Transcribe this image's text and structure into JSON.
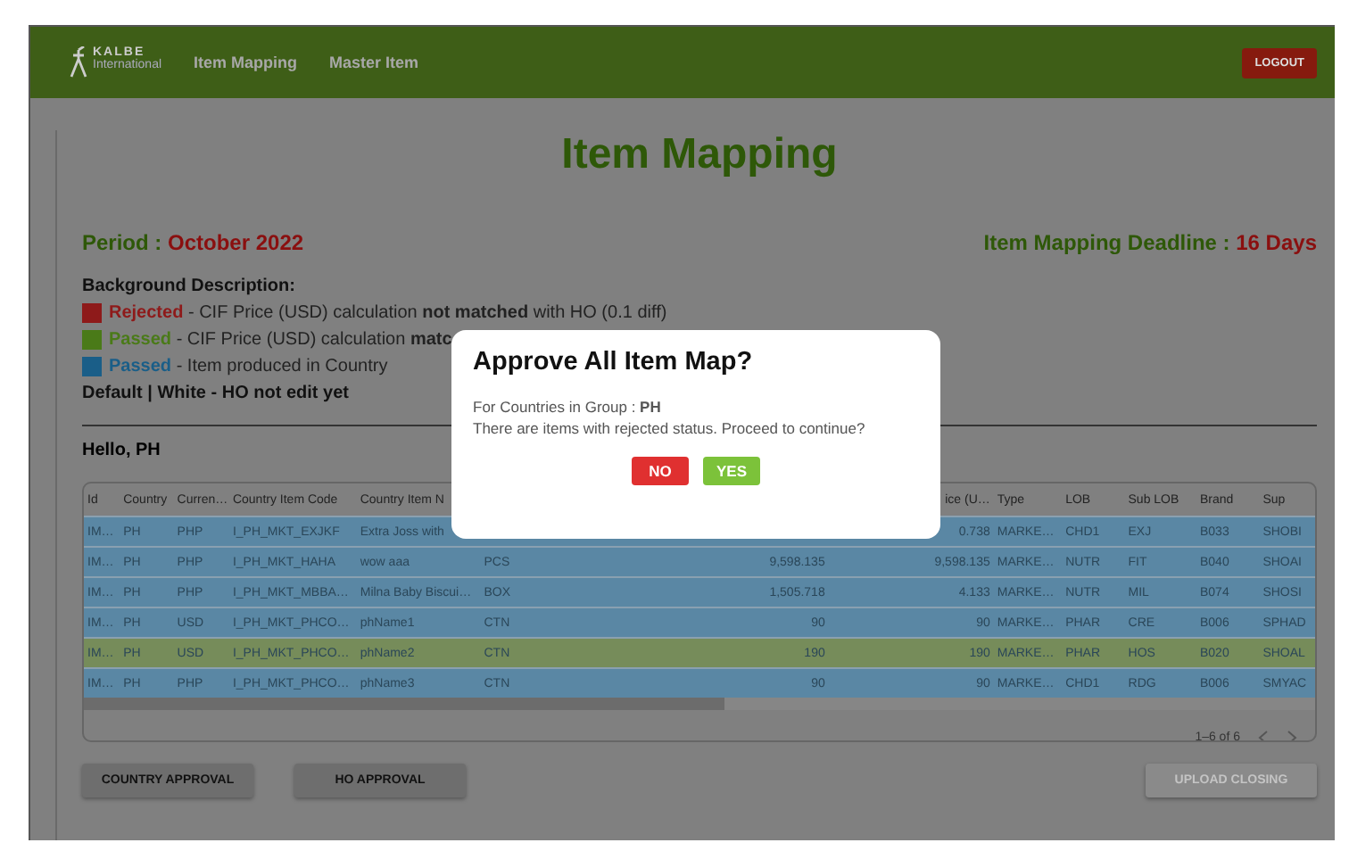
{
  "nav": {
    "logo_name": "KALBE",
    "logo_sub": "International",
    "links": [
      {
        "label": "Item Mapping"
      },
      {
        "label": "Master Item"
      }
    ],
    "logout": "LOGOUT"
  },
  "title": "Item Mapping",
  "period": {
    "label": "Period :",
    "value": "October 2022"
  },
  "deadline": {
    "label": "Item Mapping Deadline :",
    "value": "16 Days"
  },
  "background": {
    "heading": "Background Description:",
    "legend": [
      {
        "color": "#8e1a1a",
        "label": "Rejected",
        "text": "- CIF Price (USD) calculation **not matched** with HO (0.1 diff)"
      },
      {
        "color": "#4a7a18",
        "label": "Passed",
        "text": "- CIF Price (USD) calculation **matc**"
      },
      {
        "color": "#1a5e88",
        "label": "Passed",
        "text": "- Item produced in Country"
      }
    ],
    "default_note": "Default | White - HO not edit yet"
  },
  "greeting": "Hello, PH",
  "table": {
    "columns": [
      {
        "label": "Id"
      },
      {
        "label": "Country"
      },
      {
        "label": "Curren…"
      },
      {
        "label": "Country Item Code"
      },
      {
        "label": "Country Item N"
      },
      {},
      {},
      {
        "label": "ice (U…"
      },
      {
        "label": "Type"
      },
      {
        "label": "LOB"
      },
      {
        "label": "Sub LOB"
      },
      {
        "label": "Brand"
      },
      {
        "label": "Sup"
      }
    ],
    "rows": [
      {
        "color": "#5a87a4",
        "cells": [
          "IM…",
          "PH",
          "PHP",
          "I_PH_MKT_EXJKF",
          "Extra Joss with",
          null,
          null,
          "0.738",
          "MARKE…",
          "CHD1",
          "EXJ",
          "B033",
          "SHOBI"
        ]
      },
      {
        "color": "#5a87a4",
        "cells": [
          "IM…",
          "PH",
          "PHP",
          "I_PH_MKT_HAHA",
          "wow aaa",
          "PCS",
          "9,598.135",
          "9,598.135",
          "MARKE…",
          "NUTR",
          "FIT",
          "B040",
          "SHOAI"
        ]
      },
      {
        "color": "#5a87a4",
        "cells": [
          "IM…",
          "PH",
          "PHP",
          "I_PH_MKT_MBBA…",
          "Milna Baby Biscui…",
          "BOX",
          "1,505.718",
          "4.133",
          "MARKE…",
          "NUTR",
          "MIL",
          "B074",
          "SHOSI"
        ]
      },
      {
        "color": "#5a87a4",
        "cells": [
          "IM…",
          "PH",
          "USD",
          "I_PH_MKT_PHCO…",
          "phName1",
          "CTN",
          "90",
          "90",
          "MARKE…",
          "PHAR",
          "CRE",
          "B006",
          "SPHAD"
        ]
      },
      {
        "color": "#768c5a",
        "cells": [
          "IM…",
          "PH",
          "USD",
          "I_PH_MKT_PHCO…",
          "phName2",
          "CTN",
          "190",
          "190",
          "MARKE…",
          "PHAR",
          "HOS",
          "B020",
          "SHOAL"
        ]
      },
      {
        "color": "#5a87a4",
        "cells": [
          "IM…",
          "PH",
          "PHP",
          "I_PH_MKT_PHCO…",
          "phName3",
          "CTN",
          "90",
          "90",
          "MARKE…",
          "CHD1",
          "RDG",
          "B006",
          "SMYAC"
        ]
      }
    ],
    "pagination": "1–6 of 6"
  },
  "buttons": [
    {
      "label": "COUNTRY APPROVAL",
      "disabled": false
    },
    {
      "label": "HO APPROVAL",
      "disabled": false
    },
    {
      "label": "UPLOAD CLOSING",
      "disabled": true
    }
  ],
  "modal": {
    "title": "Approve All Item Map?",
    "group_label": "For Countries in Group :",
    "group_value": "PH",
    "message": "There are items with rejected status. Proceed to continue?",
    "buttons": [
      {
        "label": "NO",
        "kind": "no"
      },
      {
        "label": "YES",
        "kind": "yes"
      }
    ]
  }
}
